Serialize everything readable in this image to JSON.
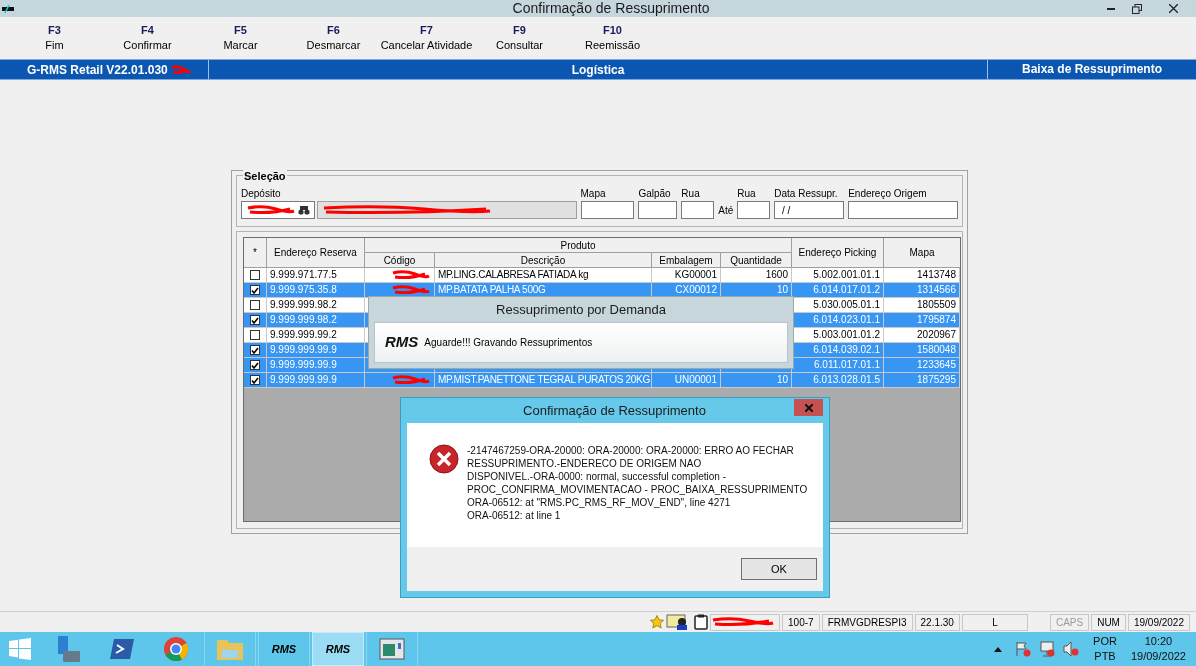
{
  "window": {
    "title": "Confirmação de Ressuprimento"
  },
  "function_keys": [
    {
      "key": "F3",
      "label": "Fim"
    },
    {
      "key": "F4",
      "label": "Confirmar"
    },
    {
      "key": "F5",
      "label": "Marcar"
    },
    {
      "key": "F6",
      "label": "Desmarcar"
    },
    {
      "key": "F7",
      "label": "Cancelar Atividade"
    },
    {
      "key": "F9",
      "label": "Consultar"
    },
    {
      "key": "F10",
      "label": "Reemissão"
    }
  ],
  "header_bar": {
    "version": "G-RMS Retail V22.01.030",
    "module": "Logística",
    "screen": "Baixa de Ressuprimento"
  },
  "selection": {
    "title": "Seleção",
    "deposit_label": "Depósito",
    "map_label": "Mapa",
    "warehouse_label": "Galpão",
    "street_from_label": "Rua",
    "until_label": "Até",
    "street_to_label": "Rua",
    "date_label": "Data Ressupr.",
    "date_value": " / /",
    "origin_label": "Endereço Origem"
  },
  "table": {
    "columns": {
      "select": "*",
      "reserve": "Endereço Reserva",
      "group": "Produto",
      "code": "Código",
      "description": "Descrição",
      "packaging": "Embalagem",
      "quantity": "Quantidade",
      "picking": "Endereço Picking",
      "map": "Mapa"
    },
    "rows": [
      {
        "checked": false,
        "reserve": "9.999.971.77.5",
        "description": "MP.LING.CALABRESA FATIADA kg",
        "packaging": "KG00001",
        "quantity": "1600",
        "picking": "5.002.001.01.1",
        "map": "1413748",
        "redacted": true
      },
      {
        "checked": true,
        "reserve": "9.999.975.35.8",
        "description": "MP.BATATA PALHA 500G",
        "packaging": "CX00012",
        "quantity": "10",
        "picking": "6.014.017.01.2",
        "map": "1314566",
        "redacted": true
      },
      {
        "checked": false,
        "reserve": "9.999.999.98.2",
        "picking": "5.030.005.01.1",
        "map": "1805509",
        "redacted": false
      },
      {
        "checked": true,
        "reserve": "9.999.999.98.2",
        "picking": "6.014.023.01.1",
        "map": "1795874",
        "redacted": false
      },
      {
        "checked": false,
        "reserve": "9.999.999.99.2",
        "picking": "5.003.001.01.2",
        "map": "2020967",
        "redacted": false
      },
      {
        "checked": true,
        "reserve": "9.999.999.99.9",
        "picking": "6.014.039.02.1",
        "map": "1580048",
        "redacted": false
      },
      {
        "checked": true,
        "reserve": "9.999.999.99.9",
        "picking": "6.011.017.01.1",
        "map": "1233645",
        "redacted": false
      },
      {
        "checked": true,
        "reserve": "9.999.999.99.9",
        "description": "MP.MIST.PANETTONE TEGRAL PURATOS 20KG",
        "packaging": "UN00001",
        "quantity": "10",
        "picking": "6.013.028.01.5",
        "map": "1875295",
        "redacted": true
      }
    ]
  },
  "progress_dialog": {
    "title": "Ressuprimento por Demanda",
    "logo": "RMS",
    "message": "Aguarde!!! Gravando Ressuprimentos"
  },
  "error_dialog": {
    "title": "Confirmação de Ressuprimento",
    "message_lines": [
      "-2147467259-ORA-20000: ORA-20000: ORA-20000: ERRO AO FECHAR",
      "RESSUPRIMENTO.-ENDERECO DE ORIGEM NAO",
      "DISPONIVEL.-ORA-0000: normal, successful completion -",
      "PROC_CONFIRMA_MOVIMENTACAO - PROC_BAIXA_RESSUPRIMENTO",
      "ORA-06512: at \"RMS.PC_RMS_RF_MOV_END\", line 4271",
      "ORA-06512: at line 1"
    ],
    "button": "OK"
  },
  "status_bar": [
    {
      "text": "100-7",
      "disabled": false
    },
    {
      "text": "FRMVGDRESPI3",
      "disabled": false
    },
    {
      "text": "22.1.30",
      "disabled": false
    },
    {
      "text": "L",
      "disabled": false
    },
    {
      "text": "CAPS",
      "disabled": true
    },
    {
      "text": "NUM",
      "disabled": false
    },
    {
      "text": "19/09/2022",
      "disabled": false
    }
  ],
  "taskbar": {
    "apps": [
      {
        "kind": "server",
        "selected": false
      },
      {
        "kind": "terminal",
        "selected": false
      },
      {
        "kind": "browser",
        "selected": false
      },
      {
        "kind": "folder",
        "selected": false
      },
      {
        "kind": "rms",
        "label": "RMS",
        "selected": false
      },
      {
        "kind": "rms",
        "label": "RMS",
        "selected": true
      },
      {
        "kind": "window",
        "selected": false
      }
    ],
    "language": "POR",
    "layout": "PTB",
    "time": "10:20",
    "date": "19/09/2022"
  }
}
